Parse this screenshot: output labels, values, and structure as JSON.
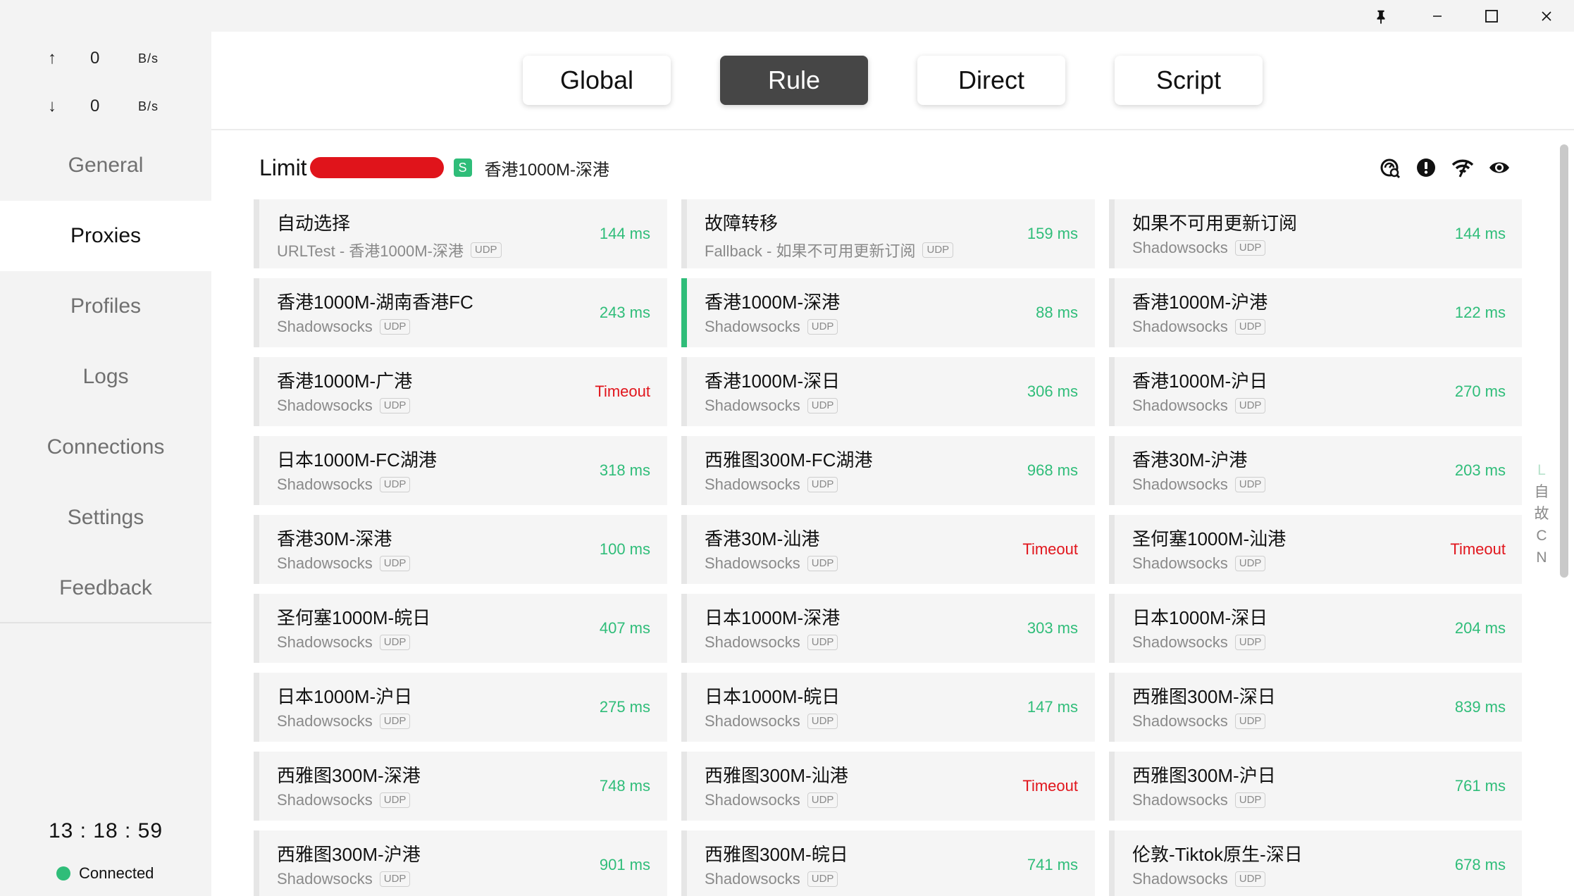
{
  "window": {
    "icons": [
      "pin-icon",
      "minimize-icon",
      "maximize-icon",
      "close-icon"
    ]
  },
  "traffic": {
    "up": {
      "arrow": "↑",
      "value": "0",
      "unit": "B/s"
    },
    "down": {
      "arrow": "↓",
      "value": "0",
      "unit": "B/s"
    }
  },
  "nav": {
    "items": [
      {
        "label": "General"
      },
      {
        "label": "Proxies"
      },
      {
        "label": "Profiles"
      },
      {
        "label": "Logs"
      },
      {
        "label": "Connections"
      },
      {
        "label": "Settings"
      },
      {
        "label": "Feedback"
      }
    ],
    "active": "Proxies"
  },
  "status": {
    "time": "13 : 18 : 59",
    "connection": "Connected",
    "connection_color": "#2fbd79"
  },
  "modes": {
    "items": [
      {
        "label": "Global"
      },
      {
        "label": "Rule"
      },
      {
        "label": "Direct"
      },
      {
        "label": "Script"
      }
    ],
    "active": "Rule"
  },
  "group": {
    "name": "Limit",
    "badge": "S",
    "selected": "香港1000M-深港",
    "icons": [
      "latency-test-icon",
      "alert-icon",
      "wifi-signal-icon",
      "eye-icon"
    ]
  },
  "colors": {
    "accent": "#2fbd79",
    "timeout": "#e1151c",
    "active_mode": "#464646",
    "redaction": "#e0141b"
  },
  "proxies": [
    {
      "name": "自动选择",
      "type": "URLTest - 香港1000M-深港",
      "udp": "UDP",
      "delay": "144 ms"
    },
    {
      "name": "故障转移",
      "type": "Fallback - 如果不可用更新订阅",
      "udp": "UDP",
      "delay": "159 ms"
    },
    {
      "name": "如果不可用更新订阅",
      "type": "Shadowsocks",
      "udp": "UDP",
      "delay": "144 ms"
    },
    {
      "name": "香港1000M-湖南香港FC",
      "type": "Shadowsocks",
      "udp": "UDP",
      "delay": "243 ms"
    },
    {
      "name": "香港1000M-深港",
      "type": "Shadowsocks",
      "udp": "UDP",
      "delay": "88 ms",
      "selected": true
    },
    {
      "name": "香港1000M-沪港",
      "type": "Shadowsocks",
      "udp": "UDP",
      "delay": "122 ms"
    },
    {
      "name": "香港1000M-广港",
      "type": "Shadowsocks",
      "udp": "UDP",
      "delay": "Timeout",
      "timeout": true
    },
    {
      "name": "香港1000M-深日",
      "type": "Shadowsocks",
      "udp": "UDP",
      "delay": "306 ms"
    },
    {
      "name": "香港1000M-沪日",
      "type": "Shadowsocks",
      "udp": "UDP",
      "delay": "270 ms"
    },
    {
      "name": "日本1000M-FC湖港",
      "type": "Shadowsocks",
      "udp": "UDP",
      "delay": "318 ms"
    },
    {
      "name": "西雅图300M-FC湖港",
      "type": "Shadowsocks",
      "udp": "UDP",
      "delay": "968 ms"
    },
    {
      "name": "香港30M-沪港",
      "type": "Shadowsocks",
      "udp": "UDP",
      "delay": "203 ms"
    },
    {
      "name": "香港30M-深港",
      "type": "Shadowsocks",
      "udp": "UDP",
      "delay": "100 ms"
    },
    {
      "name": "香港30M-汕港",
      "type": "Shadowsocks",
      "udp": "UDP",
      "delay": "Timeout",
      "timeout": true
    },
    {
      "name": "圣何塞1000M-汕港",
      "type": "Shadowsocks",
      "udp": "UDP",
      "delay": "Timeout",
      "timeout": true
    },
    {
      "name": "圣何塞1000M-皖日",
      "type": "Shadowsocks",
      "udp": "UDP",
      "delay": "407 ms"
    },
    {
      "name": "日本1000M-深港",
      "type": "Shadowsocks",
      "udp": "UDP",
      "delay": "303 ms"
    },
    {
      "name": "日本1000M-深日",
      "type": "Shadowsocks",
      "udp": "UDP",
      "delay": "204 ms"
    },
    {
      "name": "日本1000M-沪日",
      "type": "Shadowsocks",
      "udp": "UDP",
      "delay": "275 ms"
    },
    {
      "name": "日本1000M-皖日",
      "type": "Shadowsocks",
      "udp": "UDP",
      "delay": "147 ms"
    },
    {
      "name": "西雅图300M-深日",
      "type": "Shadowsocks",
      "udp": "UDP",
      "delay": "839 ms"
    },
    {
      "name": "西雅图300M-深港",
      "type": "Shadowsocks",
      "udp": "UDP",
      "delay": "748 ms"
    },
    {
      "name": "西雅图300M-汕港",
      "type": "Shadowsocks",
      "udp": "UDP",
      "delay": "Timeout",
      "timeout": true
    },
    {
      "name": "西雅图300M-沪日",
      "type": "Shadowsocks",
      "udp": "UDP",
      "delay": "761 ms"
    },
    {
      "name": "西雅图300M-沪港",
      "type": "Shadowsocks",
      "udp": "UDP",
      "delay": "901 ms"
    },
    {
      "name": "西雅图300M-皖日",
      "type": "Shadowsocks",
      "udp": "UDP",
      "delay": "741 ms"
    },
    {
      "name": "伦敦-Tiktok原生-深日",
      "type": "Shadowsocks",
      "udp": "UDP",
      "delay": "678 ms"
    }
  ],
  "side_index": [
    "L",
    "自",
    "故",
    "C",
    "N"
  ]
}
